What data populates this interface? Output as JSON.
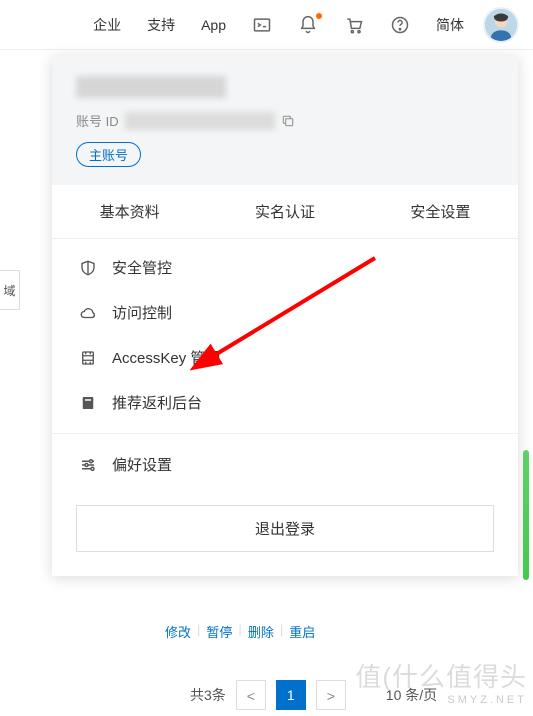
{
  "topbar": {
    "enterprise": "企业",
    "support": "支持",
    "app": "App",
    "lang": "简体"
  },
  "dropdown": {
    "account_id_label": "账号 ID",
    "account_tag": "主账号",
    "tabs": {
      "profile": "基本资料",
      "verify": "实名认证",
      "security": "安全设置"
    },
    "menu": {
      "sec_control": "安全管控",
      "access_control": "访问控制",
      "accesskey": "AccessKey 管理",
      "rebate": "推荐返利后台",
      "preference": "偏好设置"
    },
    "logout": "退出登录"
  },
  "background": {
    "links": {
      "edit": "修改",
      "pause": "暂停",
      "delete": "删除",
      "restart": "重启"
    },
    "pager": {
      "total": "共3条",
      "current": "1",
      "size": "10 条/页"
    }
  },
  "side_label": "域",
  "watermark": {
    "main": "值(什么值得头",
    "sub": "SMYZ.NET"
  }
}
